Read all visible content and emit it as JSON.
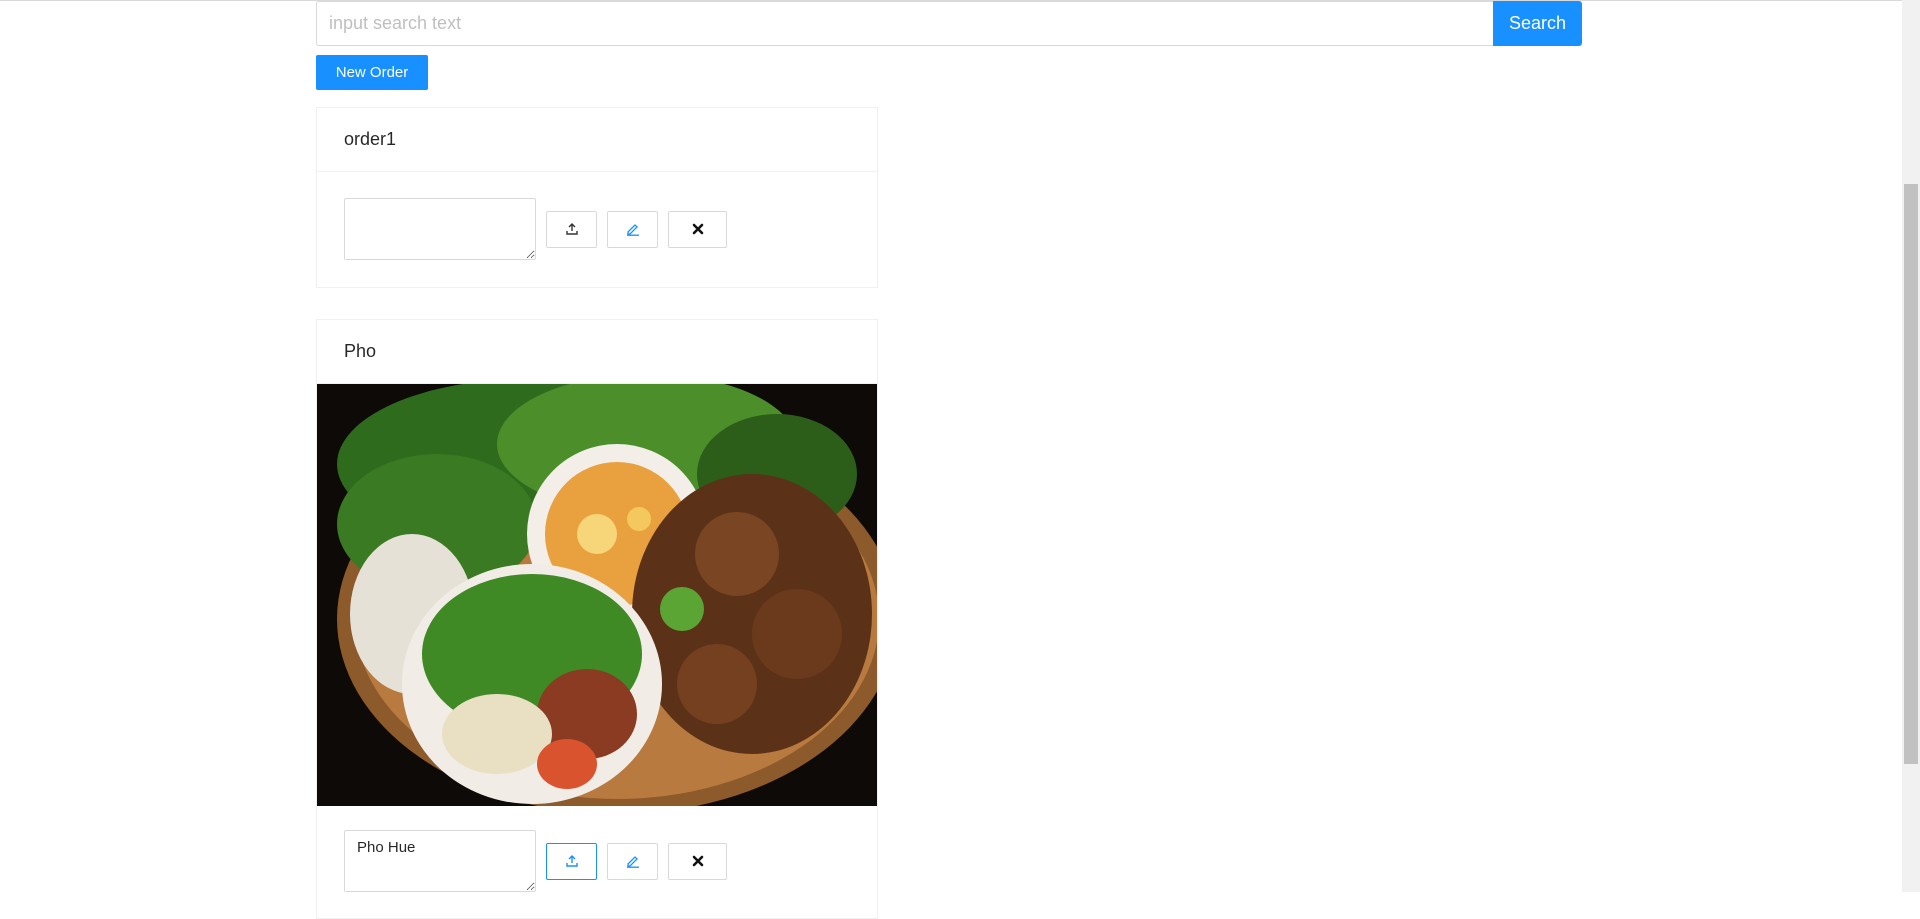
{
  "search": {
    "placeholder": "input search text",
    "value": "",
    "button_label": "Search"
  },
  "new_order_label": "New Order",
  "orders": [
    {
      "title": "order1",
      "note": "",
      "has_image": false
    },
    {
      "title": "Pho",
      "note": "Pho Hue",
      "has_image": true
    }
  ],
  "icons": {
    "upload": "upload-icon",
    "edit": "edit-icon",
    "delete": "close-icon"
  },
  "colors": {
    "primary": "#1890ff",
    "border": "#d9d9d9"
  }
}
